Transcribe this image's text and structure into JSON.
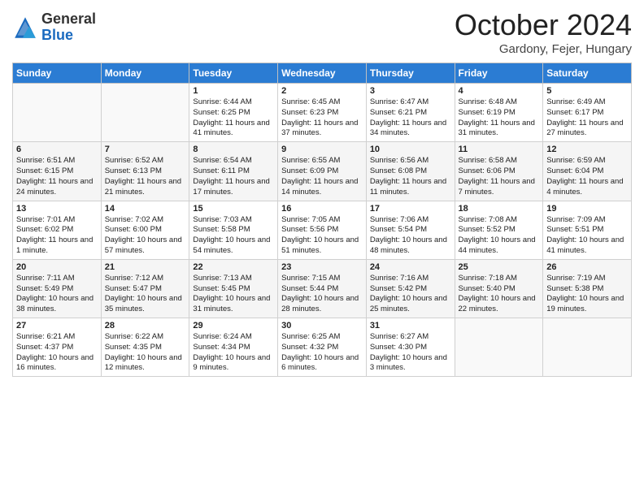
{
  "header": {
    "logo": {
      "general": "General",
      "blue": "Blue"
    },
    "title": "October 2024",
    "location": "Gardony, Fejer, Hungary"
  },
  "days_of_week": [
    "Sunday",
    "Monday",
    "Tuesday",
    "Wednesday",
    "Thursday",
    "Friday",
    "Saturday"
  ],
  "weeks": [
    [
      {
        "day": "",
        "info": ""
      },
      {
        "day": "",
        "info": ""
      },
      {
        "day": "1",
        "info": "Sunrise: 6:44 AM\nSunset: 6:25 PM\nDaylight: 11 hours and 41 minutes."
      },
      {
        "day": "2",
        "info": "Sunrise: 6:45 AM\nSunset: 6:23 PM\nDaylight: 11 hours and 37 minutes."
      },
      {
        "day": "3",
        "info": "Sunrise: 6:47 AM\nSunset: 6:21 PM\nDaylight: 11 hours and 34 minutes."
      },
      {
        "day": "4",
        "info": "Sunrise: 6:48 AM\nSunset: 6:19 PM\nDaylight: 11 hours and 31 minutes."
      },
      {
        "day": "5",
        "info": "Sunrise: 6:49 AM\nSunset: 6:17 PM\nDaylight: 11 hours and 27 minutes."
      }
    ],
    [
      {
        "day": "6",
        "info": "Sunrise: 6:51 AM\nSunset: 6:15 PM\nDaylight: 11 hours and 24 minutes."
      },
      {
        "day": "7",
        "info": "Sunrise: 6:52 AM\nSunset: 6:13 PM\nDaylight: 11 hours and 21 minutes."
      },
      {
        "day": "8",
        "info": "Sunrise: 6:54 AM\nSunset: 6:11 PM\nDaylight: 11 hours and 17 minutes."
      },
      {
        "day": "9",
        "info": "Sunrise: 6:55 AM\nSunset: 6:09 PM\nDaylight: 11 hours and 14 minutes."
      },
      {
        "day": "10",
        "info": "Sunrise: 6:56 AM\nSunset: 6:08 PM\nDaylight: 11 hours and 11 minutes."
      },
      {
        "day": "11",
        "info": "Sunrise: 6:58 AM\nSunset: 6:06 PM\nDaylight: 11 hours and 7 minutes."
      },
      {
        "day": "12",
        "info": "Sunrise: 6:59 AM\nSunset: 6:04 PM\nDaylight: 11 hours and 4 minutes."
      }
    ],
    [
      {
        "day": "13",
        "info": "Sunrise: 7:01 AM\nSunset: 6:02 PM\nDaylight: 11 hours and 1 minute."
      },
      {
        "day": "14",
        "info": "Sunrise: 7:02 AM\nSunset: 6:00 PM\nDaylight: 10 hours and 57 minutes."
      },
      {
        "day": "15",
        "info": "Sunrise: 7:03 AM\nSunset: 5:58 PM\nDaylight: 10 hours and 54 minutes."
      },
      {
        "day": "16",
        "info": "Sunrise: 7:05 AM\nSunset: 5:56 PM\nDaylight: 10 hours and 51 minutes."
      },
      {
        "day": "17",
        "info": "Sunrise: 7:06 AM\nSunset: 5:54 PM\nDaylight: 10 hours and 48 minutes."
      },
      {
        "day": "18",
        "info": "Sunrise: 7:08 AM\nSunset: 5:52 PM\nDaylight: 10 hours and 44 minutes."
      },
      {
        "day": "19",
        "info": "Sunrise: 7:09 AM\nSunset: 5:51 PM\nDaylight: 10 hours and 41 minutes."
      }
    ],
    [
      {
        "day": "20",
        "info": "Sunrise: 7:11 AM\nSunset: 5:49 PM\nDaylight: 10 hours and 38 minutes."
      },
      {
        "day": "21",
        "info": "Sunrise: 7:12 AM\nSunset: 5:47 PM\nDaylight: 10 hours and 35 minutes."
      },
      {
        "day": "22",
        "info": "Sunrise: 7:13 AM\nSunset: 5:45 PM\nDaylight: 10 hours and 31 minutes."
      },
      {
        "day": "23",
        "info": "Sunrise: 7:15 AM\nSunset: 5:44 PM\nDaylight: 10 hours and 28 minutes."
      },
      {
        "day": "24",
        "info": "Sunrise: 7:16 AM\nSunset: 5:42 PM\nDaylight: 10 hours and 25 minutes."
      },
      {
        "day": "25",
        "info": "Sunrise: 7:18 AM\nSunset: 5:40 PM\nDaylight: 10 hours and 22 minutes."
      },
      {
        "day": "26",
        "info": "Sunrise: 7:19 AM\nSunset: 5:38 PM\nDaylight: 10 hours and 19 minutes."
      }
    ],
    [
      {
        "day": "27",
        "info": "Sunrise: 6:21 AM\nSunset: 4:37 PM\nDaylight: 10 hours and 16 minutes."
      },
      {
        "day": "28",
        "info": "Sunrise: 6:22 AM\nSunset: 4:35 PM\nDaylight: 10 hours and 12 minutes."
      },
      {
        "day": "29",
        "info": "Sunrise: 6:24 AM\nSunset: 4:34 PM\nDaylight: 10 hours and 9 minutes."
      },
      {
        "day": "30",
        "info": "Sunrise: 6:25 AM\nSunset: 4:32 PM\nDaylight: 10 hours and 6 minutes."
      },
      {
        "day": "31",
        "info": "Sunrise: 6:27 AM\nSunset: 4:30 PM\nDaylight: 10 hours and 3 minutes."
      },
      {
        "day": "",
        "info": ""
      },
      {
        "day": "",
        "info": ""
      }
    ]
  ]
}
